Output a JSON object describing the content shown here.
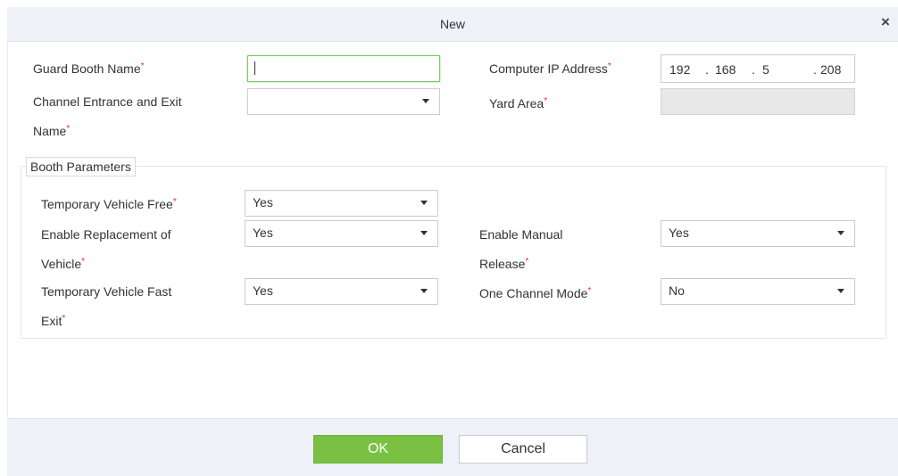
{
  "dialog": {
    "title": "New",
    "close_symbol": "×"
  },
  "form": {
    "guard_booth_name": {
      "label": "Guard Booth Name",
      "value": ""
    },
    "computer_ip": {
      "label": "Computer IP Address",
      "octets": [
        "192",
        "168",
        "5",
        "208"
      ],
      "separator": "."
    },
    "channel_name": {
      "label_line1": "Channel Entrance and Exit",
      "label_line2": "Name",
      "value": ""
    },
    "yard_area": {
      "label": "Yard Area",
      "value": ""
    },
    "required_mark": "*"
  },
  "booth_parameters": {
    "legend": "Booth Parameters",
    "temporary_vehicle_free": {
      "label": "Temporary Vehicle Free",
      "value": "Yes"
    },
    "enable_replacement": {
      "label_line1": "Enable Replacement of",
      "label_line2": "Vehicle",
      "value": "Yes"
    },
    "enable_manual_release": {
      "label_line1": "Enable Manual",
      "label_line2": "Release",
      "value": "Yes"
    },
    "temporary_fast_exit": {
      "label_line1": "Temporary Vehicle Fast",
      "label_line2": "Exit",
      "value": "Yes"
    },
    "one_channel_mode": {
      "label": "One Channel Mode",
      "value": "No"
    }
  },
  "footer": {
    "ok_label": "OK",
    "cancel_label": "Cancel"
  },
  "colors": {
    "accent": "#7ac143",
    "required": "#e03030",
    "header_bg": "#eef1f7",
    "focus_border": "#7bc86c"
  }
}
